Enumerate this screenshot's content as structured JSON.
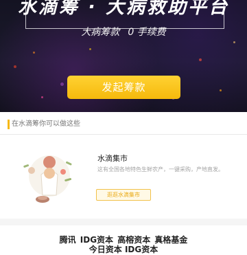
{
  "banner": {
    "headline": "水滴筹 · 大病救助平台",
    "subline_left": "大病筹款",
    "subline_right": "0 手续费",
    "cta_label": "发起筹款"
  },
  "section": {
    "header": "在水滴筹你可以做这些"
  },
  "card": {
    "title": "水滴集市",
    "description": "这有全国各地特色生鲜农产，一键采购，产地直发。",
    "link_label": "逛逛水滴集市"
  },
  "investors": {
    "line1": "腾讯 IDG资本 高榕资本 真格基金",
    "line2": "今日资本 IDG资本"
  },
  "colors": {
    "accent": "#f6b913",
    "banner_bg": "#161524"
  }
}
